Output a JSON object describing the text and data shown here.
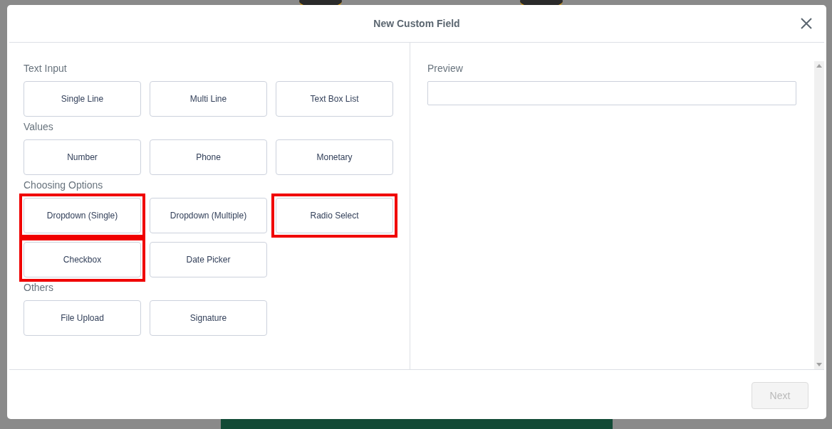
{
  "dialog": {
    "title": "New Custom Field",
    "sections": [
      {
        "label": "Text Input",
        "options": [
          {
            "label": "Single Line",
            "highlighted": false
          },
          {
            "label": "Multi Line",
            "highlighted": false
          },
          {
            "label": "Text Box List",
            "highlighted": false
          }
        ]
      },
      {
        "label": "Values",
        "options": [
          {
            "label": "Number",
            "highlighted": false
          },
          {
            "label": "Phone",
            "highlighted": false
          },
          {
            "label": "Monetary",
            "highlighted": false
          }
        ]
      },
      {
        "label": "Choosing Options",
        "options": [
          {
            "label": "Dropdown (Single)",
            "highlighted": true
          },
          {
            "label": "Dropdown (Multiple)",
            "highlighted": false
          },
          {
            "label": "Radio Select",
            "highlighted": true
          },
          {
            "label": "Checkbox",
            "highlighted": true
          },
          {
            "label": "Date Picker",
            "highlighted": false
          }
        ]
      },
      {
        "label": "Others",
        "options": [
          {
            "label": "File Upload",
            "highlighted": false
          },
          {
            "label": "Signature",
            "highlighted": false
          }
        ]
      }
    ],
    "preview": {
      "label": "Preview"
    },
    "next_button": {
      "label": "Next",
      "disabled": true
    }
  }
}
